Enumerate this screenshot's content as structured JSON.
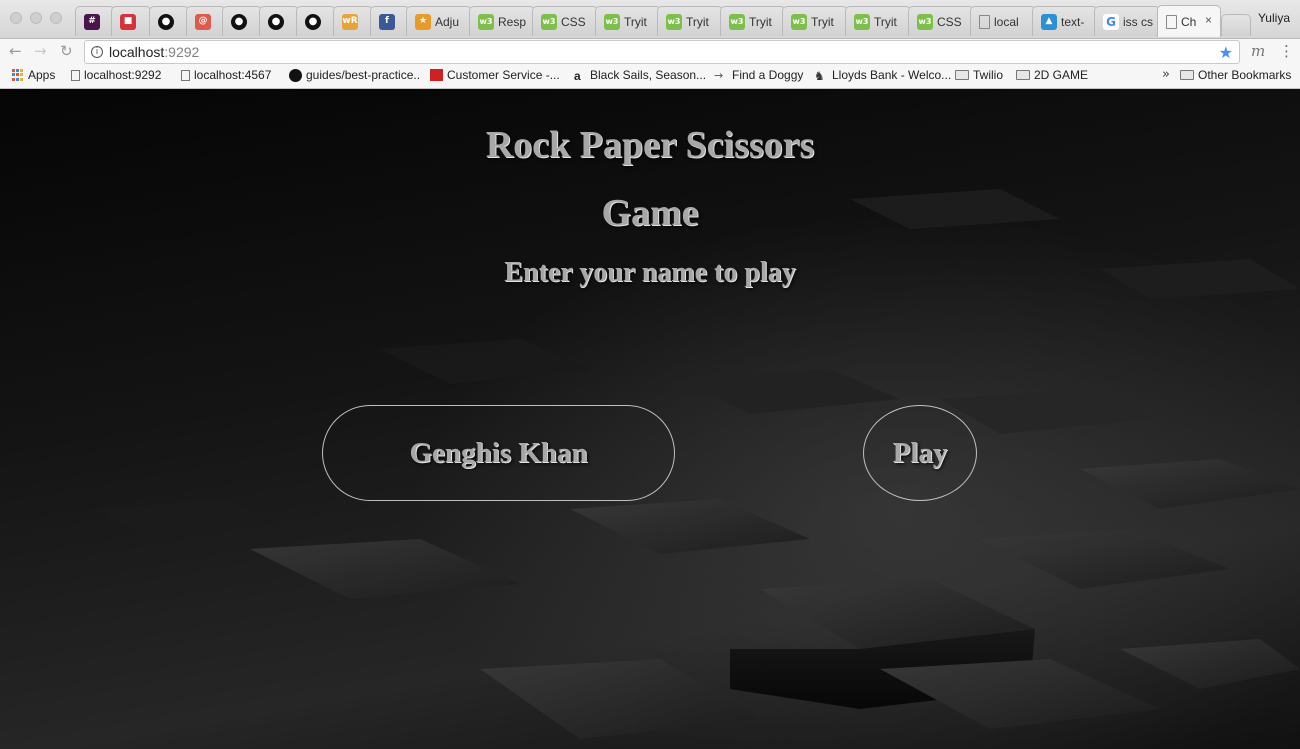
{
  "browser": {
    "tabs": [
      {
        "icon": "slack-icon",
        "glyph": "#",
        "label": "",
        "color": "#4a154b"
      },
      {
        "icon": "red-book-icon",
        "glyph": "■",
        "label": "",
        "color": "#d4333a"
      },
      {
        "icon": "github-icon",
        "glyph": "●",
        "label": ""
      },
      {
        "icon": "red-spiral-icon",
        "glyph": "@",
        "label": "",
        "color": "#e05a4a"
      },
      {
        "icon": "github-icon",
        "glyph": "●",
        "label": ""
      },
      {
        "icon": "github-icon",
        "glyph": "●",
        "label": ""
      },
      {
        "icon": "github-icon",
        "glyph": "●",
        "label": ""
      },
      {
        "icon": "wordreference-icon",
        "glyph": "wR",
        "label": "",
        "color": "#e8a33a"
      },
      {
        "icon": "facebook-icon",
        "glyph": "f",
        "label": ""
      },
      {
        "icon": "orange-icon",
        "glyph": "★",
        "label": "Adju"
      },
      {
        "icon": "w3schools-icon",
        "glyph": "w3",
        "label": "Resp"
      },
      {
        "icon": "w3schools-icon",
        "glyph": "w3",
        "label": "CSS"
      },
      {
        "icon": "w3schools-icon",
        "glyph": "w3",
        "label": "Tryit"
      },
      {
        "icon": "w3schools-icon",
        "glyph": "w3",
        "label": "Tryit"
      },
      {
        "icon": "w3schools-icon",
        "glyph": "w3",
        "label": "Tryit"
      },
      {
        "icon": "w3schools-icon",
        "glyph": "w3",
        "label": "Tryit"
      },
      {
        "icon": "w3schools-icon",
        "glyph": "w3",
        "label": "Tryit"
      },
      {
        "icon": "w3schools-icon",
        "glyph": "w3",
        "label": "CSS"
      },
      {
        "icon": "document-icon",
        "glyph": "",
        "label": "local"
      },
      {
        "icon": "blue-cap-icon",
        "glyph": "▲",
        "label": "text-"
      },
      {
        "icon": "google-icon",
        "glyph": "G",
        "label": "iss cs"
      },
      {
        "icon": "document-icon",
        "glyph": "",
        "label": "Ch",
        "active": true
      }
    ],
    "close_glyph": "×",
    "user": "Yuliya",
    "url_host": "localhost",
    "url_port": ":9292",
    "bookmarks": [
      {
        "icon": "apps-icon",
        "label": "Apps"
      },
      {
        "icon": "document-icon",
        "label": "localhost:9292"
      },
      {
        "icon": "document-icon",
        "label": "localhost:4567"
      },
      {
        "icon": "github-icon",
        "label": "guides/best-practice.."
      },
      {
        "icon": "red-box-icon",
        "label": "Customer Service -..."
      },
      {
        "icon": "amazon-icon",
        "label": "Black Sails, Season..."
      },
      {
        "icon": "dog-icon",
        "label": "Find a Doggy"
      },
      {
        "icon": "horse-icon",
        "label": "Lloyds Bank - Welco..."
      },
      {
        "icon": "folder-icon",
        "label": "Twilio"
      },
      {
        "icon": "folder-icon",
        "label": "2D GAME"
      }
    ],
    "overflow_chevron": "»",
    "other_bookmarks": "Other Bookmarks"
  },
  "page": {
    "title": "Rock Paper Scissors",
    "subtitle": "Game",
    "prompt": "Enter your name to play",
    "name_value": "Genghis Khan",
    "play_label": "Play",
    "text_color": "#a7a7a7",
    "border_color": "#bfbfbf"
  }
}
